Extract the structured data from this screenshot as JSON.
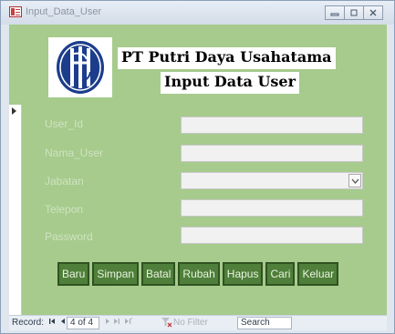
{
  "window": {
    "title": "Input_Data_User",
    "minimize_icon": "minimize-icon",
    "restore_icon": "restore-icon",
    "close_icon": "close-icon"
  },
  "header": {
    "logo_icon": "company-logo",
    "company_name": "PT Putri Daya Usahatama",
    "form_title": "Input Data User"
  },
  "fields": [
    {
      "label": "User_Id",
      "value": ""
    },
    {
      "label": "Nama_User",
      "value": ""
    },
    {
      "label": "Jabatan",
      "value": "",
      "type": "combo"
    },
    {
      "label": "Telepon",
      "value": ""
    },
    {
      "label": "Password",
      "value": ""
    }
  ],
  "buttons": [
    "Baru",
    "Simpan",
    "Batal",
    "Rubah",
    "Hapus",
    "Cari",
    "Keluar"
  ],
  "statusbar": {
    "record_label": "Record:",
    "first_icon": "first-record-icon",
    "prev_icon": "prev-record-icon",
    "position": "4 of 4",
    "next_icon": "next-record-icon",
    "last_icon": "last-record-icon",
    "new_icon": "new-record-icon",
    "filter_label": "No Filter",
    "search_label": "Search"
  },
  "colors": {
    "form_background": "#a6cb8c",
    "button_background": "#4f7f3a",
    "label_color": "#cfe3c2"
  }
}
